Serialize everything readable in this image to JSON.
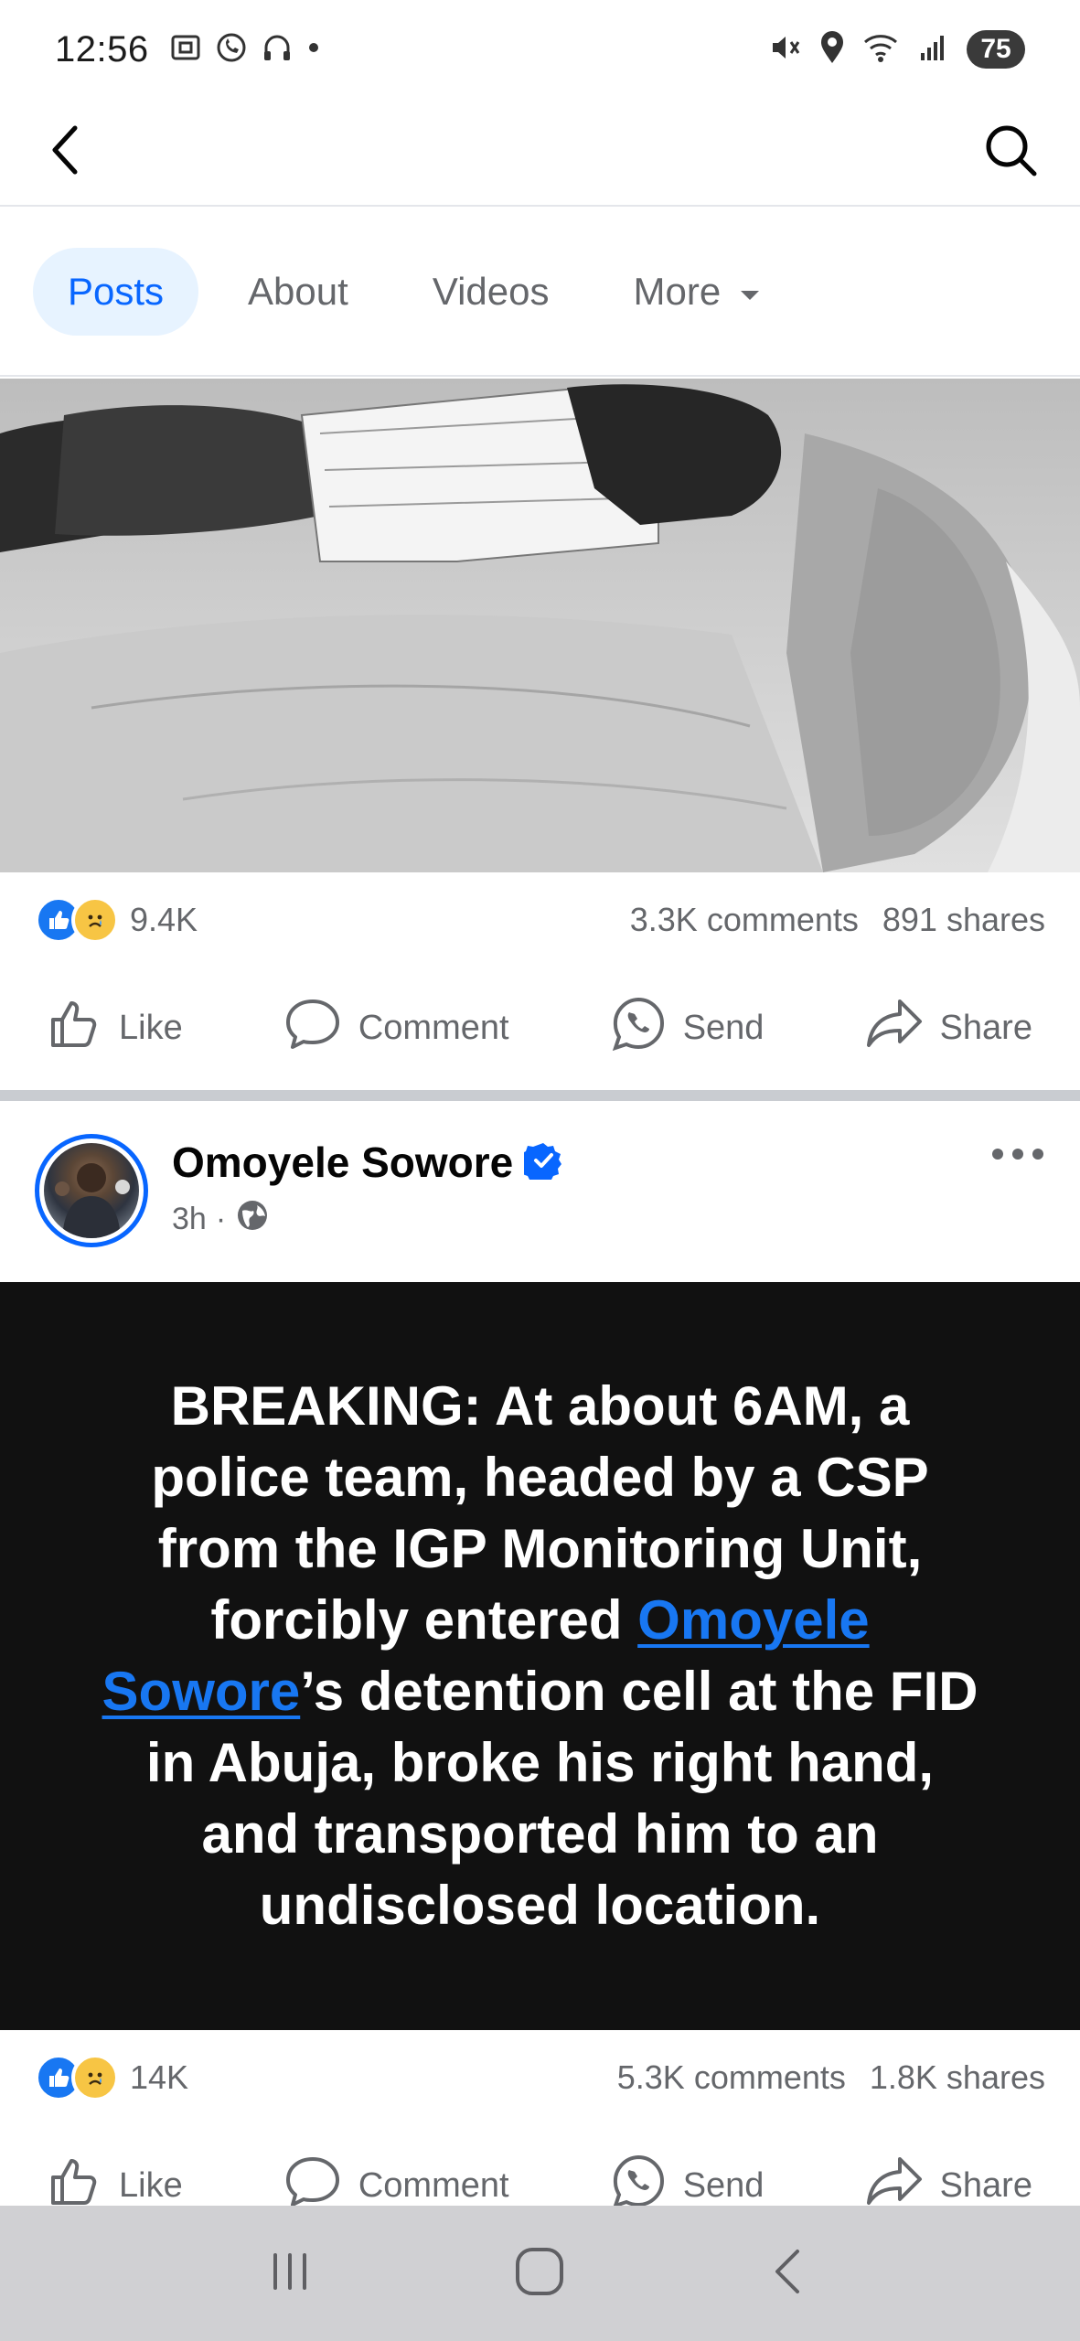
{
  "status_bar": {
    "time": "12:56",
    "battery": "75",
    "left_icons": [
      "screenshot-icon",
      "whatsapp-icon",
      "headphones-icon",
      "dot-icon"
    ],
    "right_icons": [
      "mute-icon",
      "location-icon",
      "wifi-icon",
      "signal-icon"
    ]
  },
  "top_nav": {
    "back_icon": "back-arrow-icon",
    "search_icon": "search-icon"
  },
  "tabs": [
    {
      "label": "Posts",
      "active": true
    },
    {
      "label": "About",
      "active": false
    },
    {
      "label": "Videos",
      "active": false
    },
    {
      "label": "More",
      "active": false
    }
  ],
  "post1": {
    "reaction_count": "9.4K",
    "comments": "3.3K comments",
    "shares": "891 shares",
    "actions": {
      "like": "Like",
      "comment": "Comment",
      "send": "Send",
      "share": "Share"
    }
  },
  "post2": {
    "author": "Omoyele Sowore",
    "verified": true,
    "time": "3h",
    "privacy_icon": "globe-icon",
    "text_before": "BREAKING: At about 6AM, a police team, headed by a CSP from the IGP Monitoring Unit, forcibly entered ",
    "link_text": "Omoyele Sowore",
    "text_after": "’s detention cell at the FID in Abuja, broke his right hand, and transported him to an undisclosed location.",
    "reaction_count": "14K",
    "comments": "5.3K comments",
    "shares": "1.8K shares",
    "actions": {
      "like": "Like",
      "comment": "Comment",
      "send": "Send",
      "share": "Share"
    }
  },
  "colors": {
    "accent": "#0866ff",
    "tab_active_bg": "#e7f3ff",
    "secondary_text": "#65676b",
    "card_bg": "#111111"
  }
}
